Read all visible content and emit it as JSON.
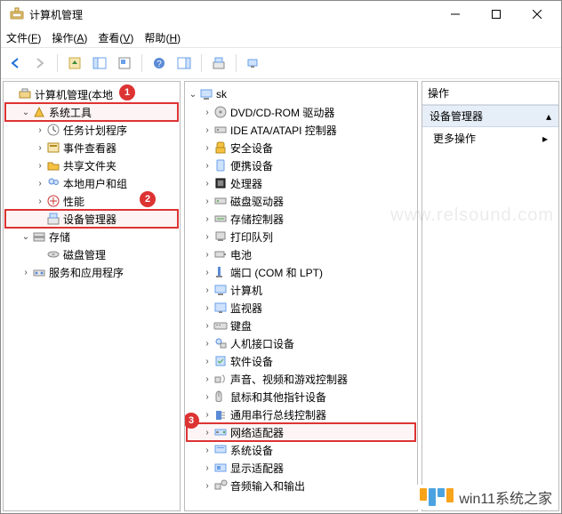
{
  "window": {
    "title": "计算机管理"
  },
  "menu": {
    "file": {
      "label": "文件",
      "accel": "F"
    },
    "action": {
      "label": "操作",
      "accel": "A"
    },
    "view": {
      "label": "查看",
      "accel": "V"
    },
    "help": {
      "label": "帮助",
      "accel": "H"
    }
  },
  "left_tree": {
    "root": "计算机管理(本地",
    "system_tools": "系统工具",
    "children": {
      "task_scheduler": "任务计划程序",
      "event_viewer": "事件查看器",
      "shared_folders": "共享文件夹",
      "local_users": "本地用户和组",
      "performance": "性能",
      "device_manager": "设备管理器"
    },
    "storage": "存储",
    "disk_mgmt": "磁盘管理",
    "services_apps": "服务和应用程序"
  },
  "center_tree": {
    "root": "sk",
    "categories": [
      "DVD/CD-ROM 驱动器",
      "IDE ATA/ATAPI 控制器",
      "安全设备",
      "便携设备",
      "处理器",
      "磁盘驱动器",
      "存储控制器",
      "打印队列",
      "电池",
      "端口 (COM 和 LPT)",
      "计算机",
      "监视器",
      "键盘",
      "人机接口设备",
      "软件设备",
      "声音、视频和游戏控制器",
      "鼠标和其他指针设备",
      "通用串行总线控制器",
      "网络适配器",
      "系统设备",
      "显示适配器",
      "音频输入和输出"
    ],
    "highlighted_index": 18
  },
  "actions": {
    "header": "操作",
    "section": "设备管理器",
    "more": "更多操作"
  },
  "annotations": {
    "b1": "1",
    "b2": "2",
    "b3": "3"
  },
  "watermark": "www.relsound.com",
  "branding": "win11系统之家"
}
